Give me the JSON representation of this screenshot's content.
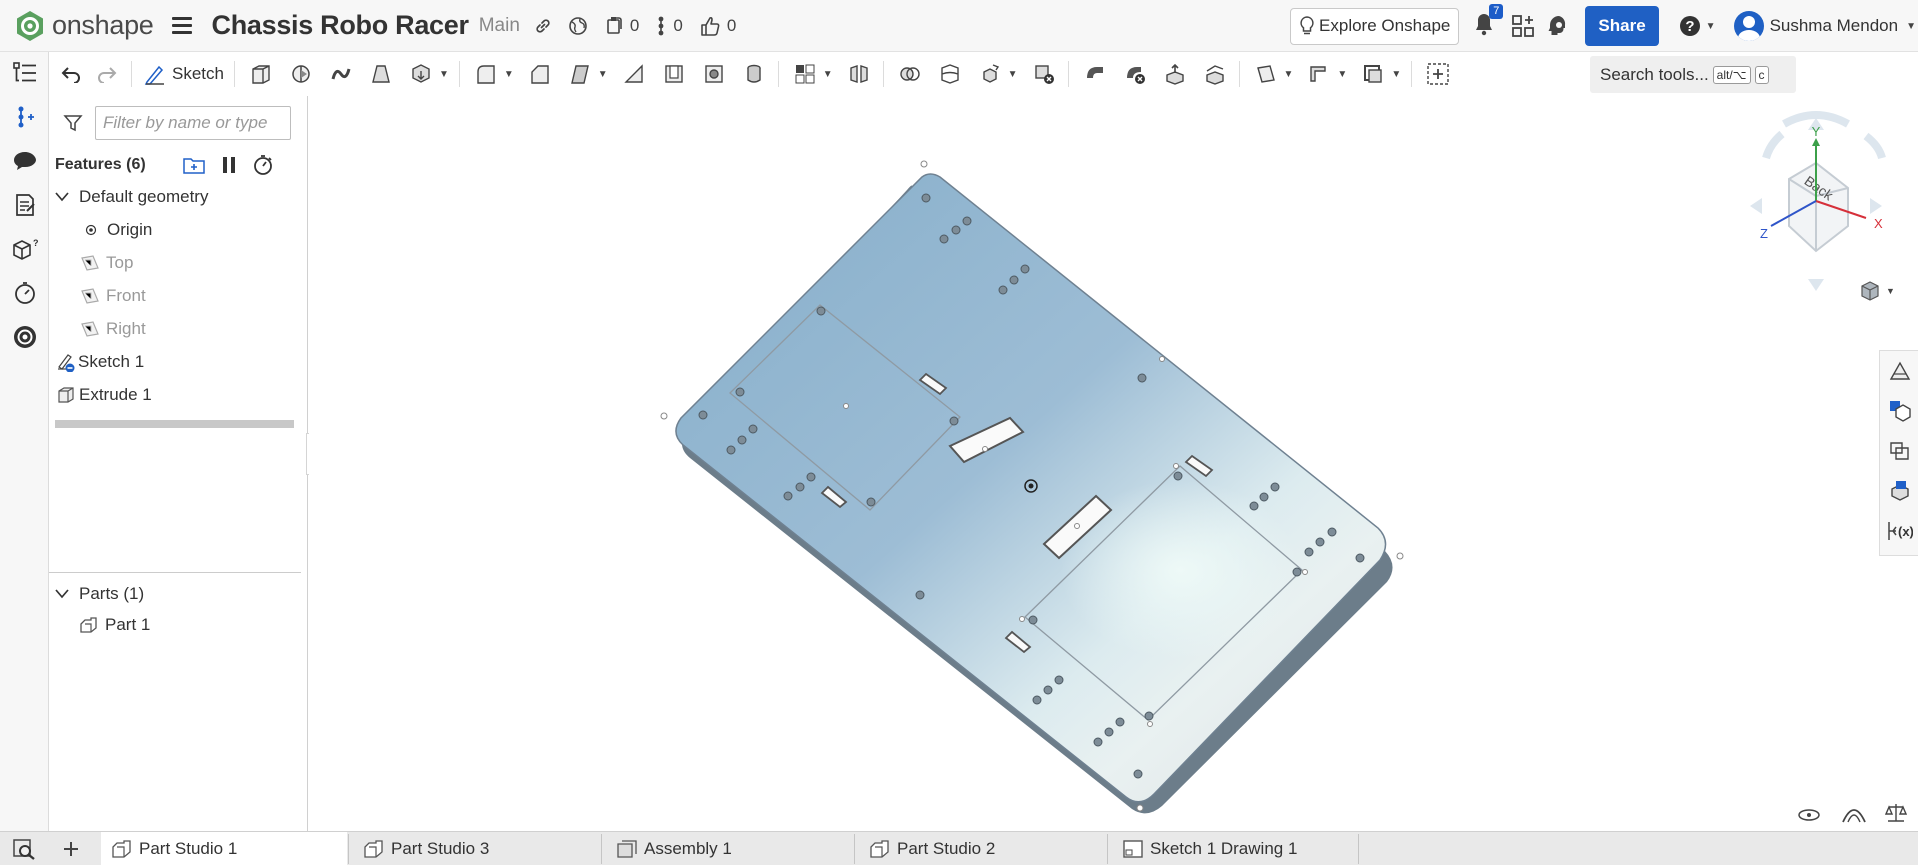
{
  "app": {
    "logo_text": "onshape",
    "document_title": "Chassis Robo Racer",
    "branch": "Main",
    "versions_count": "0",
    "branches_count": "0",
    "likes_count": "0",
    "notifications_count": "7",
    "explore_label": "Explore Onshape",
    "share_label": "Share",
    "user_name": "Sushma Mendon"
  },
  "toolbar": {
    "sketch_label": "Sketch",
    "search_label": "Search tools...",
    "search_key1": "alt/⌥",
    "search_key2": "c"
  },
  "feature_panel": {
    "filter_placeholder": "Filter by name or type",
    "features_title": "Features (6)",
    "tree": [
      {
        "label": "Default geometry"
      },
      {
        "label": "Origin"
      },
      {
        "label": "Top"
      },
      {
        "label": "Front"
      },
      {
        "label": "Right"
      },
      {
        "label": "Sketch 1"
      },
      {
        "label": "Extrude 1"
      }
    ],
    "parts_title": "Parts (1)",
    "parts": [
      {
        "label": "Part 1"
      }
    ]
  },
  "view_cube": {
    "face_label": "Back",
    "axis_x": "X",
    "axis_y": "Y",
    "axis_z": "Z"
  },
  "tabs": [
    {
      "label": "Part Studio 1",
      "active": true
    },
    {
      "label": "Part Studio 3",
      "active": false
    },
    {
      "label": "Assembly 1",
      "active": false
    },
    {
      "label": "Part Studio 2",
      "active": false
    },
    {
      "label": "Sketch 1 Drawing 1",
      "active": false
    }
  ],
  "colors": {
    "brand_green": "#3a9c4e",
    "share_blue": "#1f60c4",
    "part_blue": "#8fb3cf"
  }
}
